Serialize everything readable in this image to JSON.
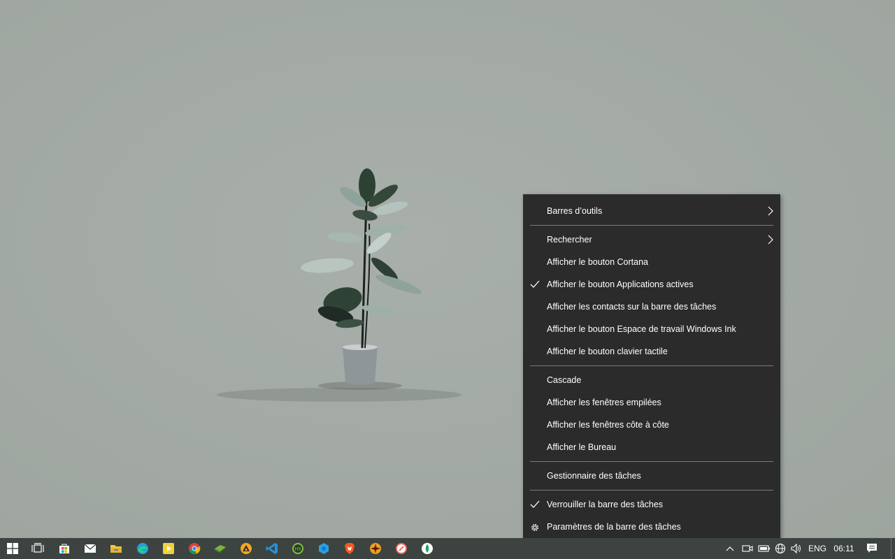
{
  "context_menu": {
    "toolbars": "Barres d’outils",
    "search": "Rechercher",
    "show_cortana": "Afficher le bouton Cortana",
    "show_task_view": "Afficher le bouton Applications actives",
    "show_people": "Afficher les contacts sur la barre des tâches",
    "show_ink": "Afficher le bouton Espace de travail Windows Ink",
    "show_keyboard": "Afficher le bouton clavier tactile",
    "cascade": "Cascade",
    "stacked": "Afficher les fenêtres empilées",
    "side_by_side": "Afficher les fenêtres côte à côte",
    "show_desktop": "Afficher le Bureau",
    "task_manager": "Gestionnaire des tâches",
    "lock_taskbar": "Verrouiller la barre des tâches",
    "taskbar_settings": "Paramètres de la barre des tâches"
  },
  "taskbar": {
    "apps": [
      "start-icon",
      "task-view-icon",
      "store-icon",
      "mail-icon",
      "file-explorer-icon",
      "edge-icon",
      "media-player-icon",
      "chrome-icon",
      "app-green-icon",
      "app-orange-icon",
      "vscode-icon",
      "app-hs-icon",
      "app-blue-icon",
      "brave-icon",
      "app-compass-icon",
      "app-red-icon",
      "app-green-dot-icon"
    ],
    "language": "ENG",
    "time": "06:11"
  },
  "colors": {
    "menu_bg": "#2b2b2b",
    "taskbar_bg": "#3d4340",
    "desktop_bg": "#a3aaa5"
  }
}
